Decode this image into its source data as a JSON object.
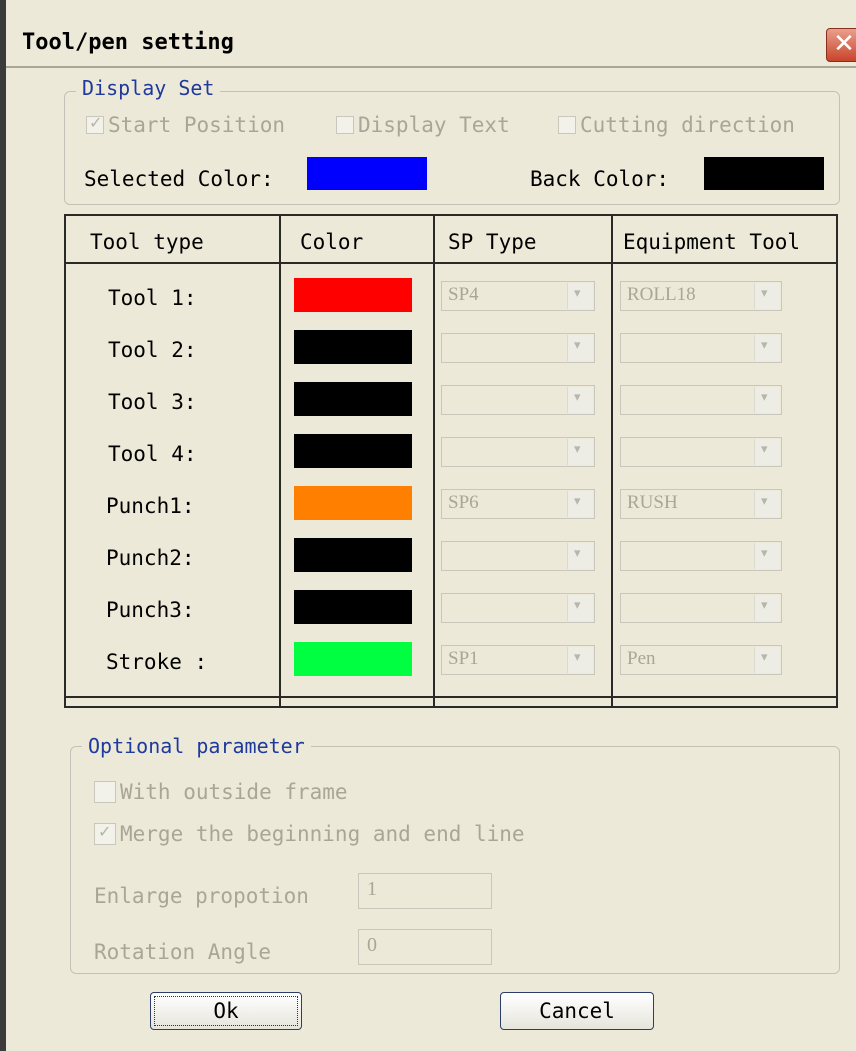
{
  "window": {
    "title": "Tool/pen setting",
    "close_glyph": "✕"
  },
  "display_set": {
    "legend": "Display Set",
    "start_position": {
      "label": "Start Position",
      "checked": true
    },
    "display_text": {
      "label": "Display Text",
      "checked": false
    },
    "cutting_direction": {
      "label": "Cutting direction",
      "checked": false
    },
    "selected_color_label": "Selected Color:",
    "selected_color": "#0000ff",
    "back_color_label": "Back Color:",
    "back_color": "#000000"
  },
  "table": {
    "headers": [
      "Tool type",
      "Color",
      "SP Type",
      "Equipment Tool"
    ],
    "rows": [
      {
        "label": "Tool 1:",
        "color": "#ff0000",
        "sp_type": "SP4",
        "equipment": "ROLL18"
      },
      {
        "label": "Tool 2:",
        "color": "#000000",
        "sp_type": "",
        "equipment": ""
      },
      {
        "label": "Tool 3:",
        "color": "#000000",
        "sp_type": "",
        "equipment": ""
      },
      {
        "label": "Tool 4:",
        "color": "#000000",
        "sp_type": "",
        "equipment": ""
      },
      {
        "label": "Punch1:",
        "color": "#ff7f00",
        "sp_type": "SP6",
        "equipment": "RUSH"
      },
      {
        "label": "Punch2:",
        "color": "#000000",
        "sp_type": "",
        "equipment": ""
      },
      {
        "label": "Punch3:",
        "color": "#000000",
        "sp_type": "",
        "equipment": ""
      },
      {
        "label": "Stroke :",
        "color": "#00ff40",
        "sp_type": "SP1",
        "equipment": "Pen"
      }
    ]
  },
  "optional": {
    "legend": "Optional parameter",
    "outside_frame": {
      "label": "With outside frame",
      "checked": false
    },
    "merge_lines": {
      "label": "Merge the beginning and end line",
      "checked": true
    },
    "enlarge_label": "Enlarge propotion",
    "enlarge_value": "1",
    "rotation_label": "Rotation Angle",
    "rotation_value": "0"
  },
  "buttons": {
    "ok": "Ok",
    "cancel": "Cancel"
  }
}
